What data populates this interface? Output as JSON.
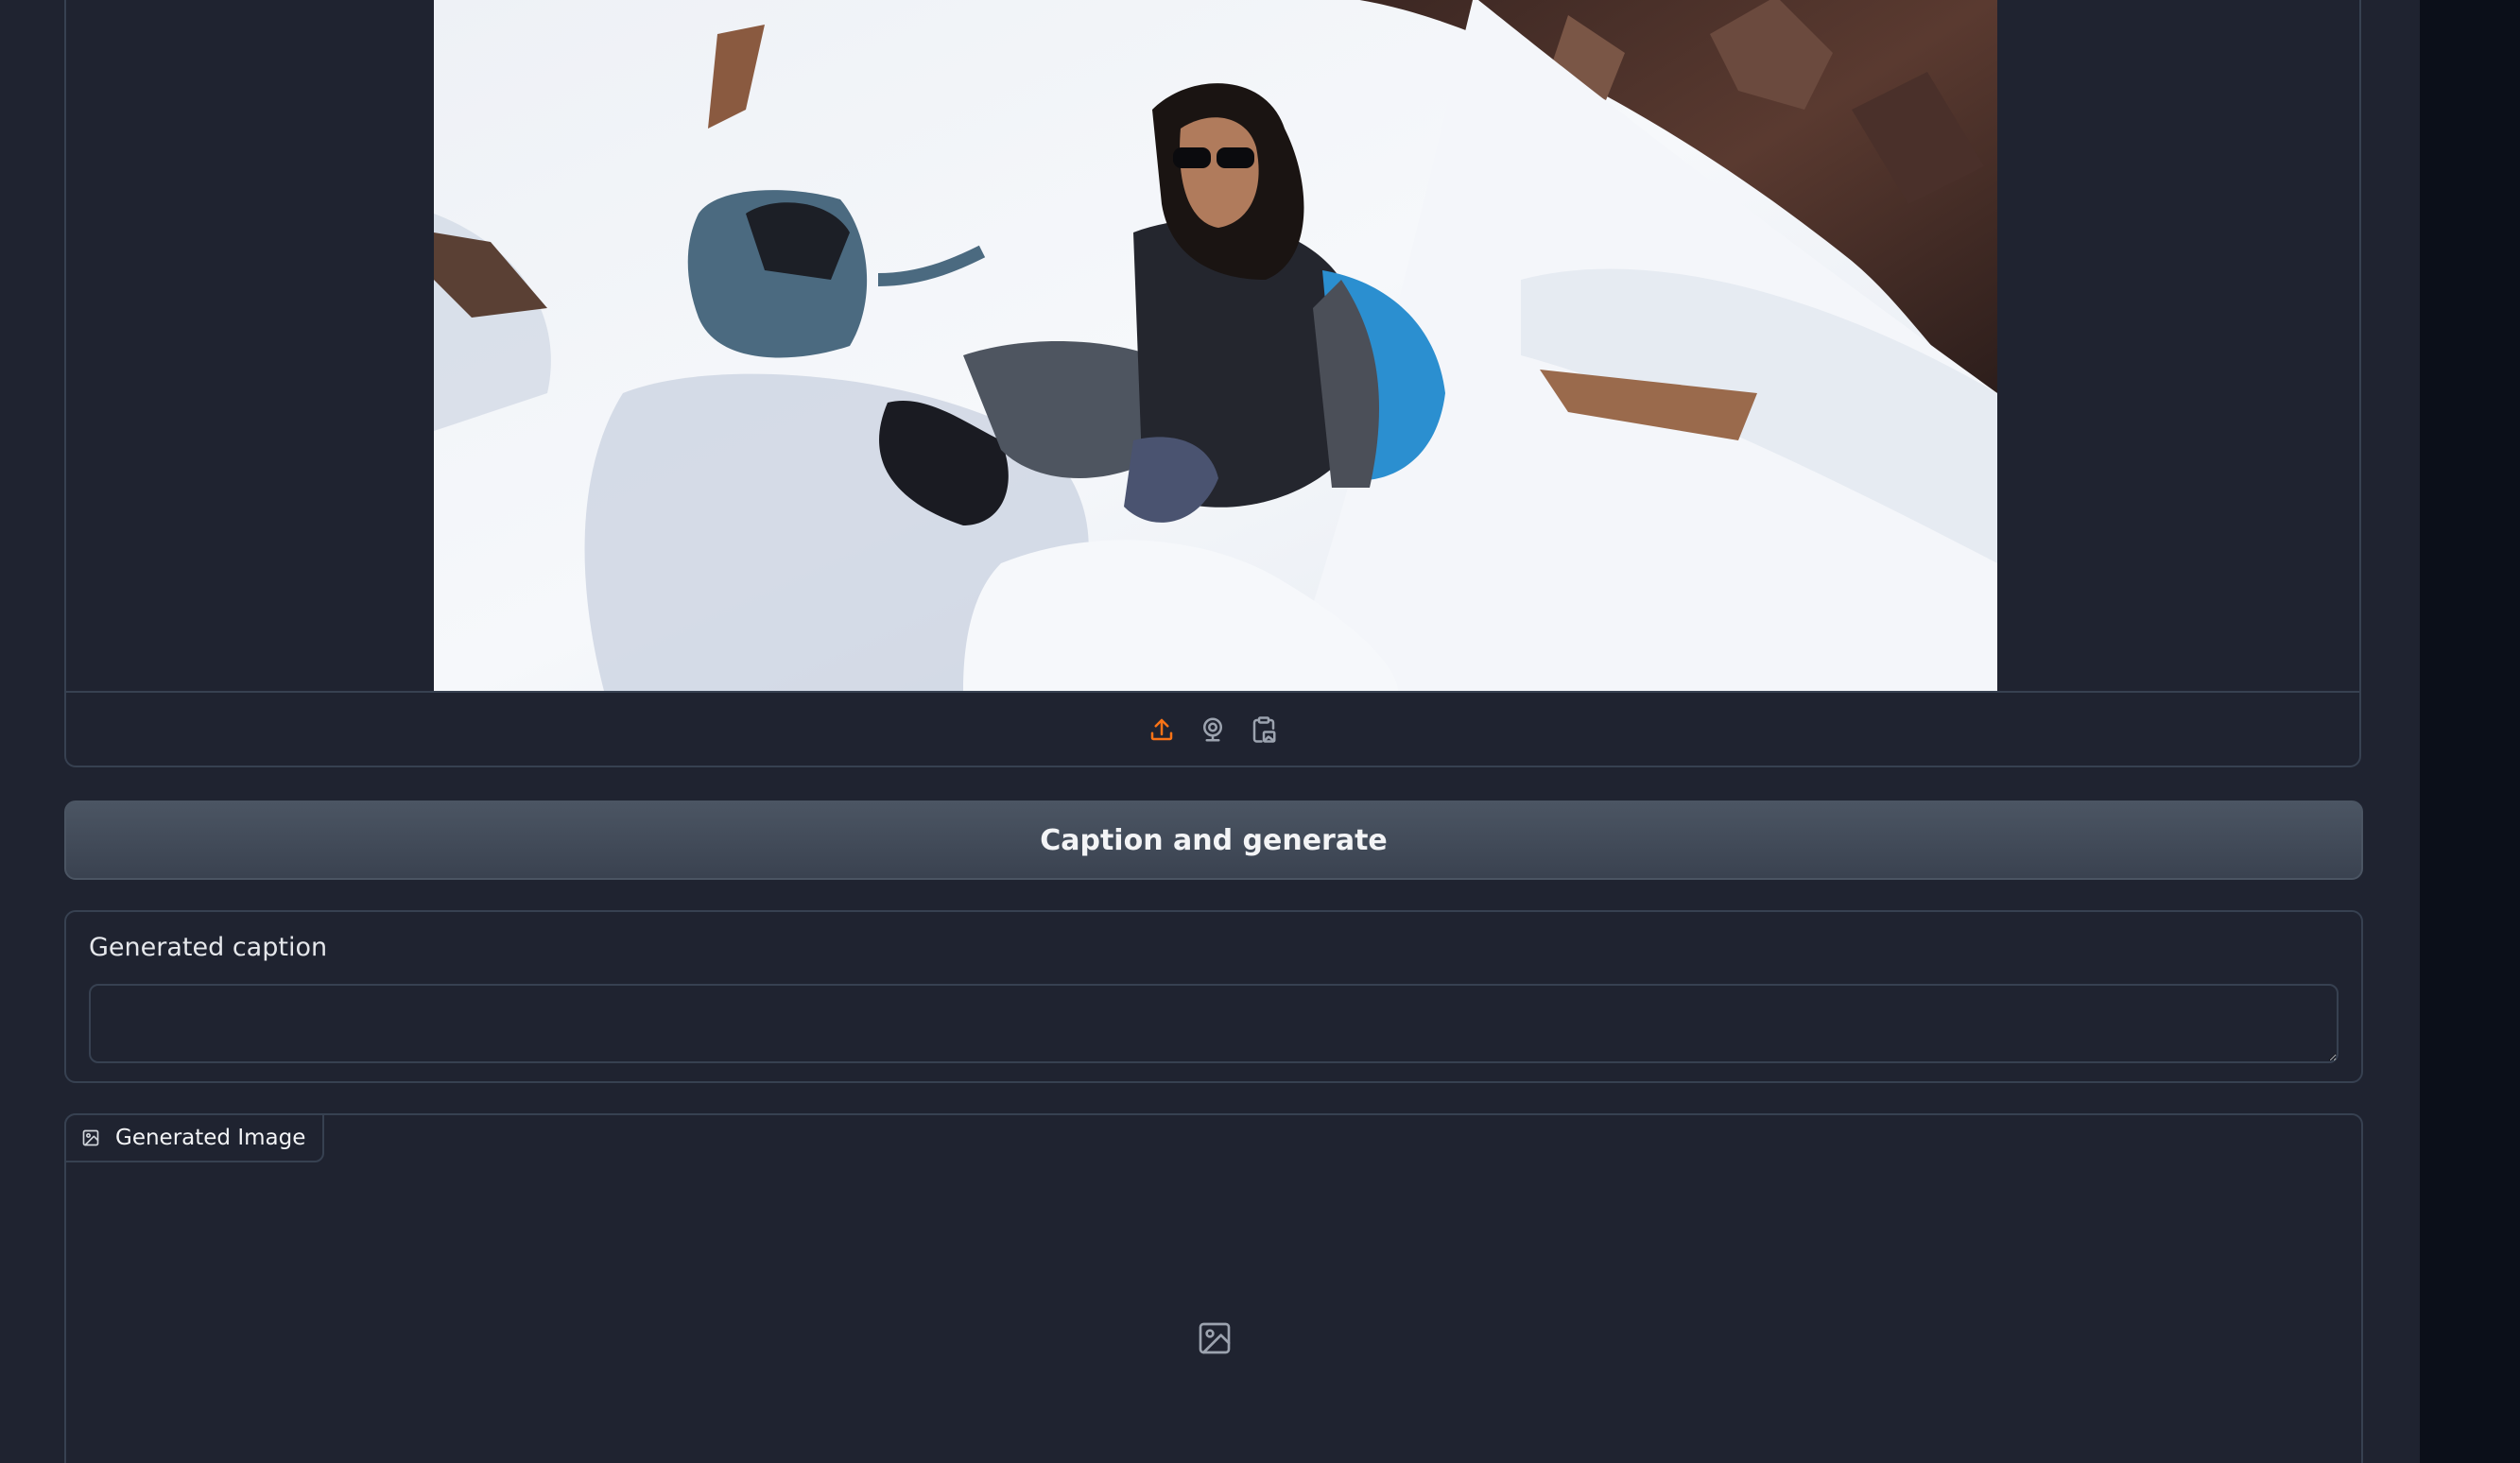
{
  "input_image": {
    "alt": "Uploaded photo",
    "source_buttons": [
      {
        "name": "upload-icon",
        "color": "#f97316"
      },
      {
        "name": "webcam-icon",
        "color": "#9ca3af"
      },
      {
        "name": "clipboard-icon",
        "color": "#9ca3af"
      }
    ]
  },
  "actions": {
    "generate_label": "Caption and generate"
  },
  "caption": {
    "label": "Generated caption",
    "value": "",
    "placeholder": ""
  },
  "output": {
    "label": "Generated Image"
  },
  "colors": {
    "background": "#0b0f19",
    "panel": "#1f2330",
    "border": "#374151",
    "accent": "#f97316"
  }
}
